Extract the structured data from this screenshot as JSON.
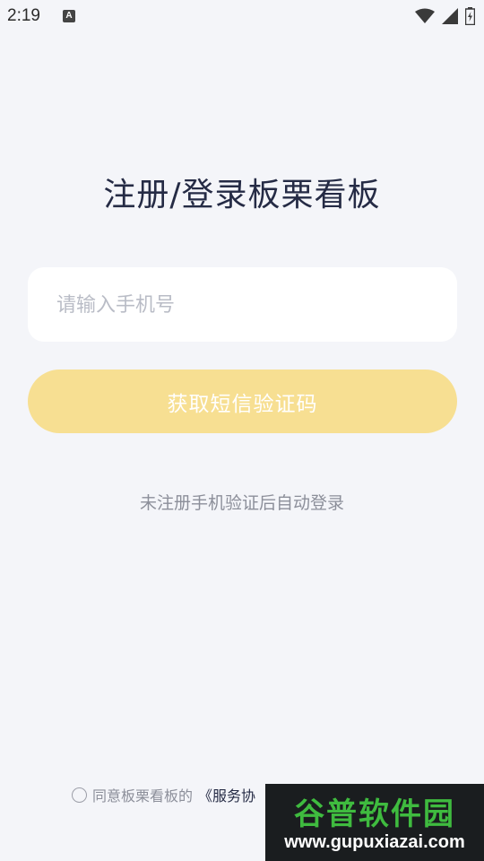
{
  "status_bar": {
    "time": "2:19",
    "notification_letter": "A"
  },
  "page": {
    "title": "注册/登录板栗看板"
  },
  "phone": {
    "placeholder": "请输入手机号",
    "value": ""
  },
  "button": {
    "label": "获取短信验证码"
  },
  "hint": "未注册手机验证后自动登录",
  "agreement": {
    "prefix": "同意板栗看板的",
    "service_link": "《服务协"
  },
  "watermark": {
    "line1": "谷普软件园",
    "line2": "www.gupuxiazai.com"
  },
  "colors": {
    "background": "#f4f5f9",
    "button": "#f7df92",
    "title": "#252b45"
  }
}
